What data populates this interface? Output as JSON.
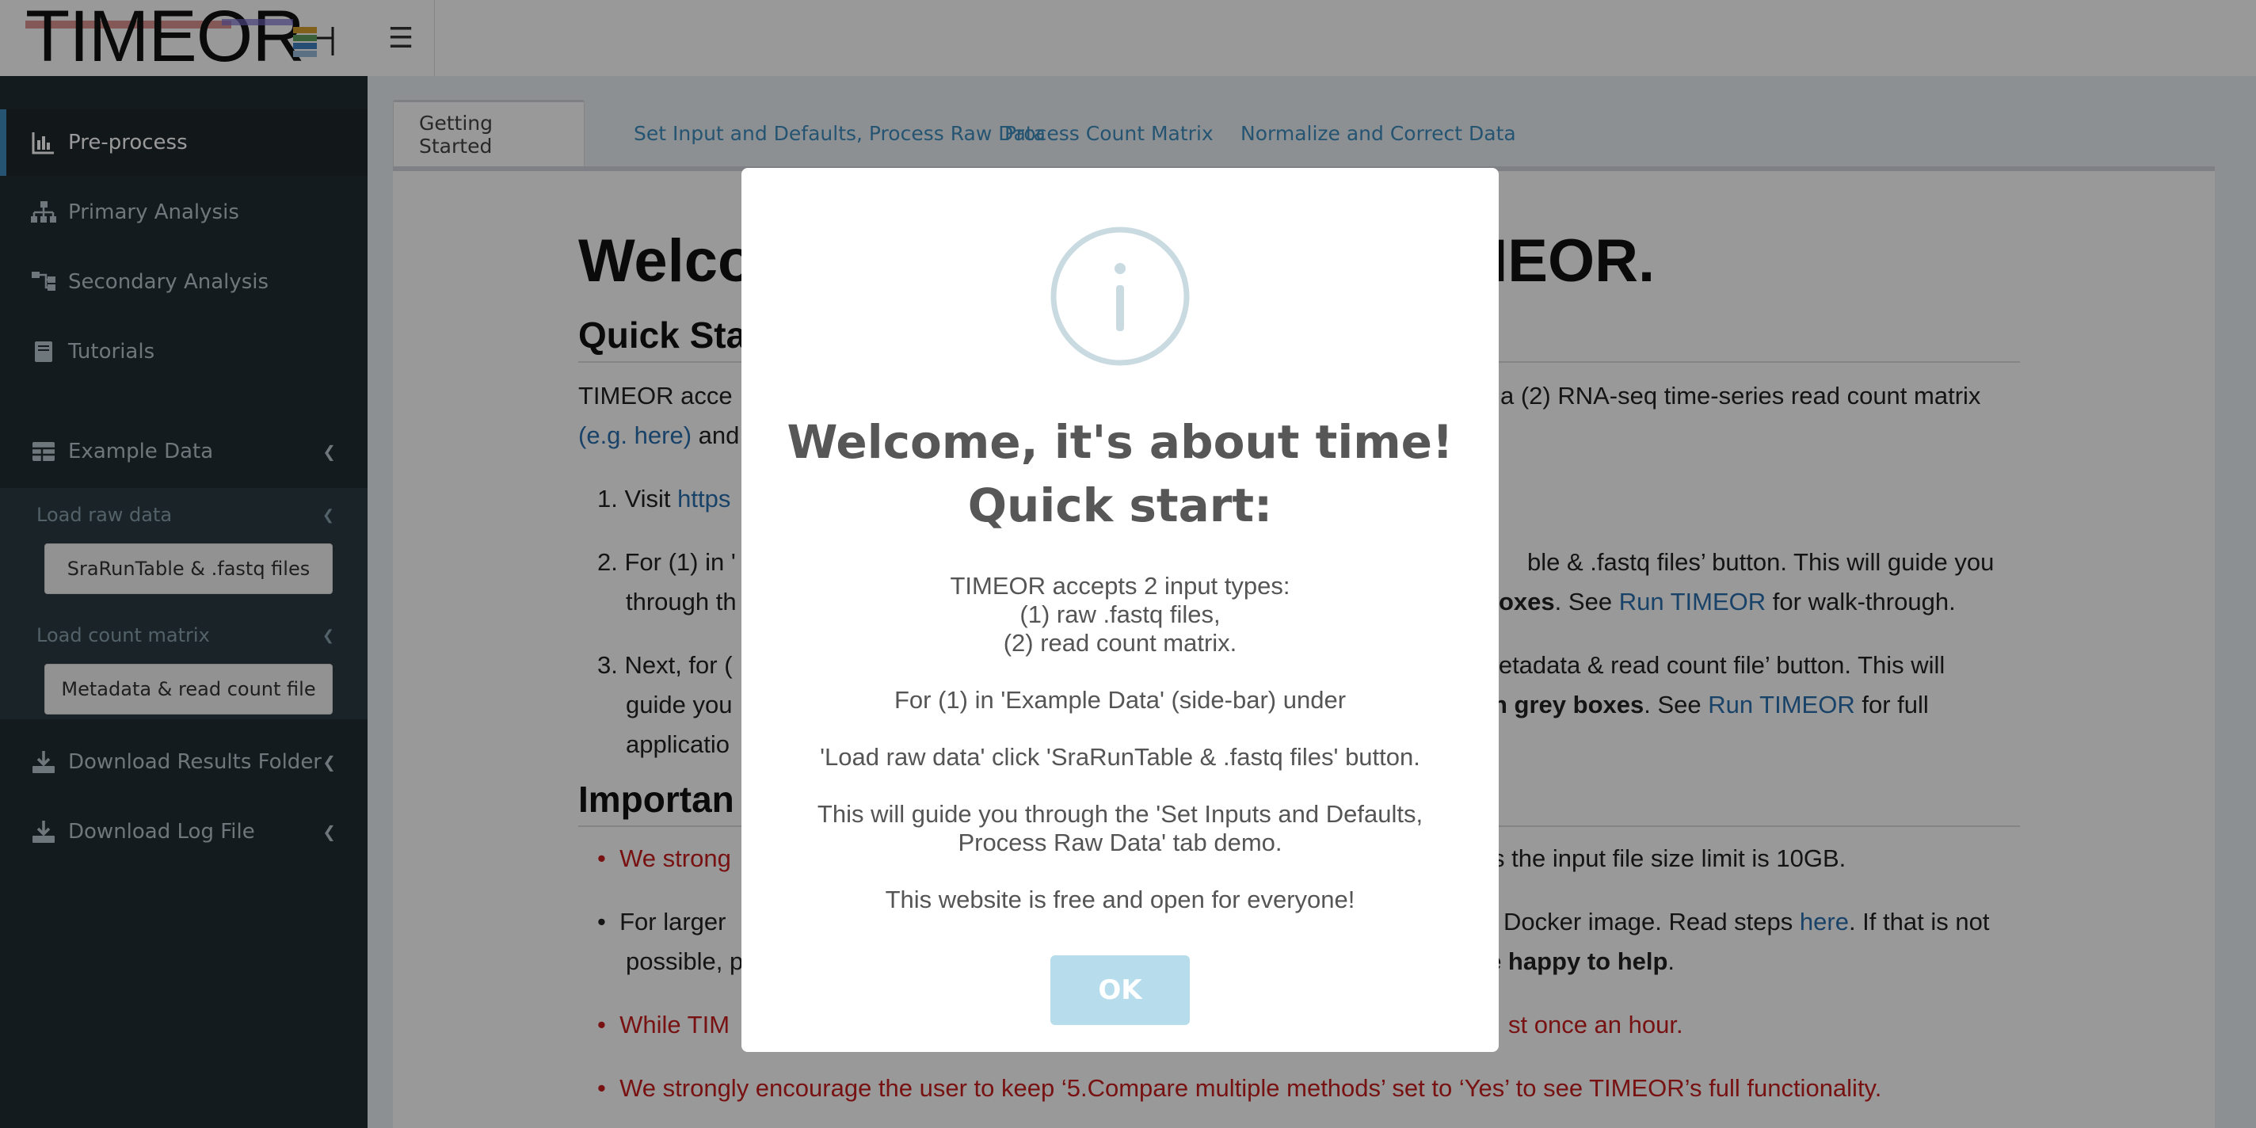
{
  "header": {
    "logo_text": "TIMEOR",
    "menu_icon": "hamburger-icon"
  },
  "sidebar": {
    "items": [
      {
        "label": "Pre-process",
        "icon": "bar-chart-icon"
      },
      {
        "label": "Primary Analysis",
        "icon": "sitemap-icon"
      },
      {
        "label": "Secondary Analysis",
        "icon": "tree-icon"
      },
      {
        "label": "Tutorials",
        "icon": "book-icon"
      },
      {
        "label": "Example Data",
        "icon": "table-icon"
      },
      {
        "label": "Download Results Folder",
        "icon": "download-icon"
      },
      {
        "label": "Download Log File",
        "icon": "download-icon"
      }
    ],
    "example_data": {
      "load_raw_label": "Load raw data",
      "raw_button": "SraRunTable & .fastq files",
      "load_count_label": "Load count matrix",
      "count_button": "Metadata & read count file"
    }
  },
  "tabs": [
    {
      "label": "Getting Started"
    },
    {
      "label": "Set Input and Defaults, Process Raw Data"
    },
    {
      "label": "Process Count Matrix"
    },
    {
      "label": "Normalize and Correct Data"
    }
  ],
  "page": {
    "welcome_left": "Welco",
    "welcome_right": "TIMEOR.",
    "quick_start_heading": "Quick Sta",
    "intro_left": "TIMEOR acce",
    "intro_right": "a (2) RNA-seq time-series read count matrix",
    "intro_link": "(e.g. here)",
    "intro_and": "and",
    "step1_prefix": "1. Visit",
    "step1_link": "https",
    "step2_prefix": "2. For (1) in '",
    "step2_right": "ble & .fastq files’ button. This will guide you",
    "step2_line2_left": "through th",
    "step2_line2_bold": "oxes",
    "step2_line2_see": ". See",
    "step2_link": "Run TIMEOR",
    "step2_line2_end": "for walk-through.",
    "step3_prefix": "3. Next, for (",
    "step3_right": "Metadata & read count file’ button. This will",
    "step3_line2_left": "guide you",
    "step3_line2_bold": "n grey boxes",
    "step3_line2_see": ". See",
    "step3_link": "Run TIMEOR",
    "step3_line2_end": "for full",
    "step3_line3": "applicatio",
    "important_heading": "Importan",
    "b1_left": "We strong",
    "b1_right": "s the input file size limit is 10GB.",
    "b2_left": "For larger",
    "b2_right": "Docker image. Read steps",
    "b2_link": "here",
    "b2_end": ". If that is not",
    "b2_line2_left": "possible, p",
    "b2_line2_bold": "re happy to help",
    "b2_line2_end": ".",
    "b3_left": "While TIM",
    "b3_right": "st once an hour.",
    "b4": "We strongly encourage the user to keep ‘5.Compare multiple methods’ set to ‘Yes’ to see TIMEOR’s full functionality."
  },
  "modal": {
    "icon": "info-icon",
    "title_line1": "Welcome, it's about time!",
    "title_line2": "Quick start:",
    "line1": "TIMEOR accepts 2 input types:",
    "line2": "(1) raw .fastq files,",
    "line3": "(2) read count matrix.",
    "line4": "For (1) in 'Example Data' (side-bar) under",
    "line5": "'Load raw data' click 'SraRunTable & .fastq files' button.",
    "line6": "This will guide you through the 'Set Inputs and Defaults, Process Raw Data' tab demo.",
    "line7": "This website is free and open for everyone!",
    "ok_label": "OK"
  }
}
